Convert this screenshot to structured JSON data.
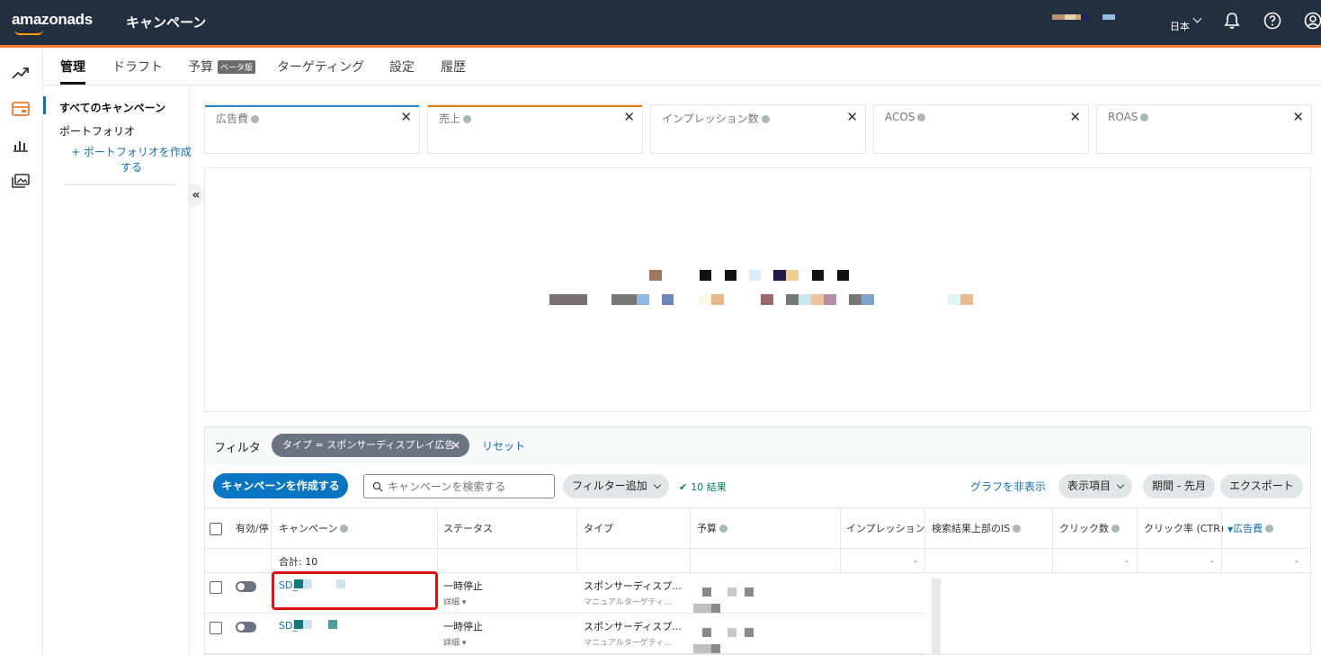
{
  "header": {
    "logo": "amazonads",
    "title": "キャンペーン",
    "language": "日本",
    "icons": [
      "bell-icon",
      "help-icon",
      "account-icon"
    ],
    "account_pixels": [
      "#b8906a",
      "#e8d3b6",
      "#c9a57a",
      "#23215a",
      "#8ec0e6"
    ]
  },
  "rail": {
    "icons": [
      "trend-icon",
      "campaign-icon",
      "bar-chart-icon",
      "media-library-icon"
    ],
    "active_color": "#f07a30"
  },
  "tabs": {
    "items": [
      "管理",
      "ドラフト",
      "予算",
      "ターゲティング",
      "設定",
      "履歴"
    ],
    "beta": "ベータ版",
    "active": "管理"
  },
  "portfolio": {
    "all_campaigns": "すべてのキャンペーン",
    "portfolio": "ポートフォリオ",
    "create": "+ ポートフォリオを作成する",
    "collapse": "«"
  },
  "metrics": [
    {
      "label": "広告費",
      "color": "#2e86c1"
    },
    {
      "label": "売上",
      "color": "#e07b00"
    },
    {
      "label": "インプレッション数",
      "color": "#e3e6e6"
    },
    {
      "label": "ACOS",
      "color": "#e3e6e6"
    },
    {
      "label": "ROAS",
      "color": "#e3e6e6"
    }
  ],
  "toolbar": {
    "filter_label": "フィルタ",
    "filter_chip": "タイプ = スポンサーディスプレイ広告",
    "reset": "リセット",
    "create_button": "キャンペーンを作成する",
    "search_placeholder": "キャンペーンを検索する",
    "add_filter": "フィルター追加",
    "results": "10 結果",
    "hide_graph": "グラフを非表示",
    "columns": "表示項目",
    "period": "期間 - 先月",
    "export": "エクスポート"
  },
  "table": {
    "headers": [
      "有効/停",
      "キャンペーン",
      "ステータス",
      "タイプ",
      "予算",
      "インプレッション",
      "検索結果上部のIS",
      "クリック数",
      "クリック率 (CTR)",
      "広告費"
    ],
    "total_label": "合計: 10",
    "total_dash": "-",
    "rows": [
      {
        "name": "SD_",
        "status": "一時停止",
        "detail": "詳細",
        "type": "スポンサーディスプ...",
        "type_sub": "マニュアルターゲティ..."
      },
      {
        "name": "SD_",
        "status": "一時停止",
        "detail": "詳細",
        "type": "スポンサーディスプ...",
        "type_sub": "マニュアルターゲティ..."
      }
    ]
  }
}
